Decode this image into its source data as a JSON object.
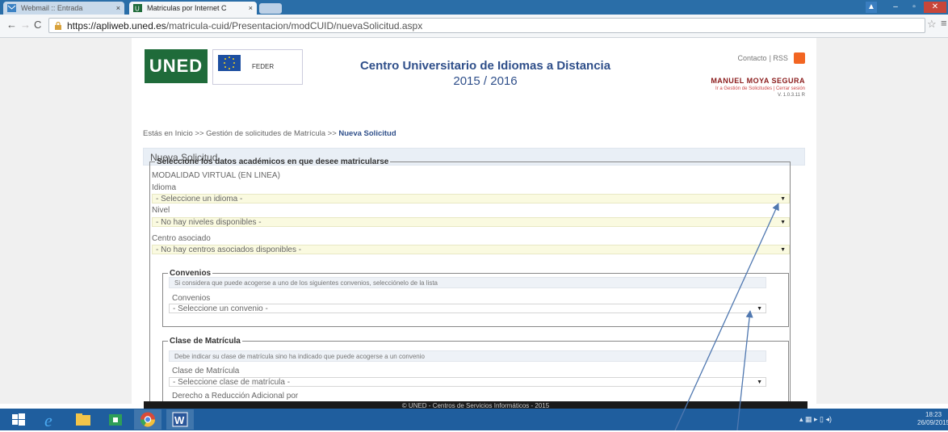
{
  "browser": {
    "tabs": [
      {
        "title": "Webmail :: Entrada",
        "active": false
      },
      {
        "title": "Matriculas por Internet C",
        "active": true
      }
    ],
    "close_glyph": "×",
    "window_buttons": [
      "▲",
      "–",
      "▫",
      "✕"
    ],
    "url_host": "https://apliweb.uned.es",
    "url_path": "/matricula-cuid/Presentacion/modCUID/nuevaSolicitud.aspx"
  },
  "page": {
    "logo_text": "UNED",
    "feder_label": "FEDER",
    "title_line1": "Centro Universitario de Idiomas a Distancia",
    "title_line2": "2015 / 2016",
    "contact_link": "Contacto",
    "rss_link": "RSS",
    "user_name": "MANUEL MOYA SEGURA",
    "user_links": "Ir a Gestión de Solicitudes | Cerrar sesión",
    "version": "V. 1.0.3.11 R",
    "breadcrumb_prefix": "Estás en Inicio >> Gestión de solicitudes de Matrícula >>",
    "breadcrumb_current": "Nueva Solicitud",
    "section_title": "Nueva Solicitud",
    "academic_legend": "Seleccione los datos académicos en que desee matricularse",
    "modality": "MODALIDAD VIRTUAL (EN LINEA)",
    "idioma_label": "Idioma",
    "idioma_value": "- Seleccione un idioma -",
    "nivel_label": "Nivel",
    "nivel_value": "- No hay niveles disponibles -",
    "centro_label": "Centro asociado",
    "centro_value": "- No hay centros asociados disponibles -",
    "convenios_legend": "Convenios",
    "convenios_info": "Si considera que puede acogerse a uno de los siguientes convenios, selecciónelo de la lista",
    "convenios_label": "Convenios",
    "convenios_value": "- Seleccione un convenio -",
    "clase_legend": "Clase de Matrícula",
    "clase_info": "Debe indicar su clase de matrícula sino ha indicado que puede acogerse a un convenio",
    "clase_label": "Clase de Matrícula",
    "clase_value": "- Seleccione clase de matrícula -",
    "derecho_label": "Derecho a Reducción Adicional por",
    "footer": "© UNED - Centros de Servicios Informáticos - 2015"
  },
  "taskbar": {
    "word_label": "W",
    "clock_time": "18:23",
    "clock_date": "26/09/2015"
  },
  "colors": {
    "uned_green": "#1f6b3a",
    "title_blue": "#2f4f8a",
    "user_red": "#8a1b1b",
    "taskbar_blue": "#1f5e9e",
    "select_yellow": "#fafae0"
  }
}
